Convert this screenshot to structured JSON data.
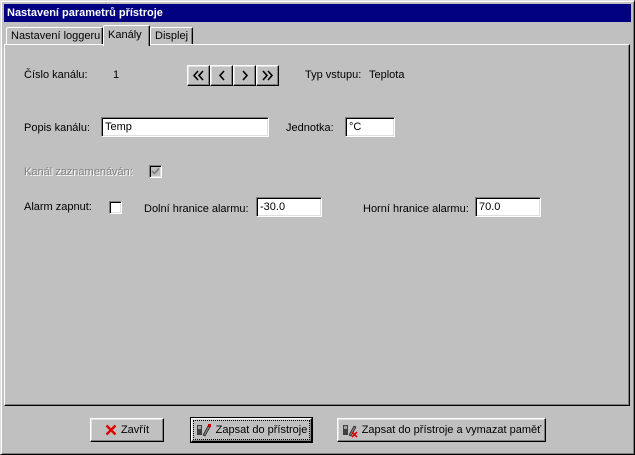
{
  "window": {
    "title": "Nastavení parametrů přístroje"
  },
  "tabs": [
    {
      "label": "Nastavení loggeru",
      "active": false
    },
    {
      "label": "Kanály",
      "active": true
    },
    {
      "label": "Displej",
      "active": false
    }
  ],
  "channel": {
    "number_label": "Číslo kanálu:",
    "number_value": "1",
    "input_type_label": "Typ vstupu:",
    "input_type_value": "Teplota",
    "description_label": "Popis kanálu:",
    "description_value": "Temp",
    "unit_label": "Jednotka:",
    "unit_value": "°C",
    "recorded_label": "Kanál zaznamenáván:",
    "recorded_checked": true,
    "alarm_label": "Alarm zapnut:",
    "alarm_checked": false,
    "alarm_low_label": "Dolní hranice alarmu:",
    "alarm_low_value": "-30.0",
    "alarm_high_label": "Horní hranice alarmu:",
    "alarm_high_value": "70.0"
  },
  "navigation": {
    "icons": [
      "first-icon",
      "previous-icon",
      "next-icon",
      "last-icon"
    ]
  },
  "buttons": {
    "close_label": "Zavřít",
    "write_label": "Zapsat do přístroje",
    "write_clear_label": "Zapsat do přístroje a vymazat paměť"
  },
  "colors": {
    "titlebar": "#000080",
    "face": "#c0c0c0",
    "disabled_text": "#808080",
    "close_icon": "#ff0000"
  }
}
